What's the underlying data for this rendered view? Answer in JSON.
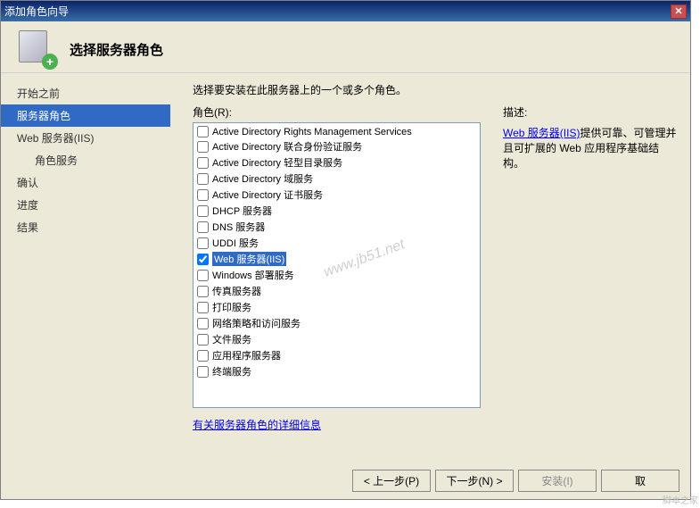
{
  "window": {
    "title": "添加角色向导"
  },
  "header": {
    "title": "选择服务器角色"
  },
  "sidebar": {
    "items": [
      {
        "label": "开始之前",
        "active": false,
        "indent": false
      },
      {
        "label": "服务器角色",
        "active": true,
        "indent": false
      },
      {
        "label": "Web 服务器(IIS)",
        "active": false,
        "indent": false
      },
      {
        "label": "角色服务",
        "active": false,
        "indent": true
      },
      {
        "label": "确认",
        "active": false,
        "indent": false
      },
      {
        "label": "进度",
        "active": false,
        "indent": false
      },
      {
        "label": "结果",
        "active": false,
        "indent": false
      }
    ]
  },
  "main": {
    "instruction": "选择要安装在此服务器上的一个或多个角色。",
    "roles_label": "角色(R):",
    "roles": [
      {
        "label": "Active Directory Rights Management Services",
        "checked": false,
        "selected": false
      },
      {
        "label": "Active Directory 联合身份验证服务",
        "checked": false,
        "selected": false
      },
      {
        "label": "Active Directory 轻型目录服务",
        "checked": false,
        "selected": false
      },
      {
        "label": "Active Directory 域服务",
        "checked": false,
        "selected": false
      },
      {
        "label": "Active Directory 证书服务",
        "checked": false,
        "selected": false
      },
      {
        "label": "DHCP 服务器",
        "checked": false,
        "selected": false
      },
      {
        "label": "DNS 服务器",
        "checked": false,
        "selected": false
      },
      {
        "label": "UDDI 服务",
        "checked": false,
        "selected": false
      },
      {
        "label": "Web 服务器(IIS)",
        "checked": true,
        "selected": true
      },
      {
        "label": "Windows 部署服务",
        "checked": false,
        "selected": false
      },
      {
        "label": "传真服务器",
        "checked": false,
        "selected": false
      },
      {
        "label": "打印服务",
        "checked": false,
        "selected": false
      },
      {
        "label": "网络策略和访问服务",
        "checked": false,
        "selected": false
      },
      {
        "label": "文件服务",
        "checked": false,
        "selected": false
      },
      {
        "label": "应用程序服务器",
        "checked": false,
        "selected": false
      },
      {
        "label": "终端服务",
        "checked": false,
        "selected": false
      }
    ],
    "desc_label": "描述:",
    "desc_link": "Web 服务器(IIS)",
    "desc_text": "提供可靠、可管理并且可扩展的 Web 应用程序基础结构。",
    "more_link": "有关服务器角色的详细信息"
  },
  "footer": {
    "prev": "< 上一步(P)",
    "next": "下一步(N) >",
    "install": "安装(I)",
    "cancel": "取"
  },
  "watermark": "www.jb51.net",
  "corner": "脚本之家"
}
